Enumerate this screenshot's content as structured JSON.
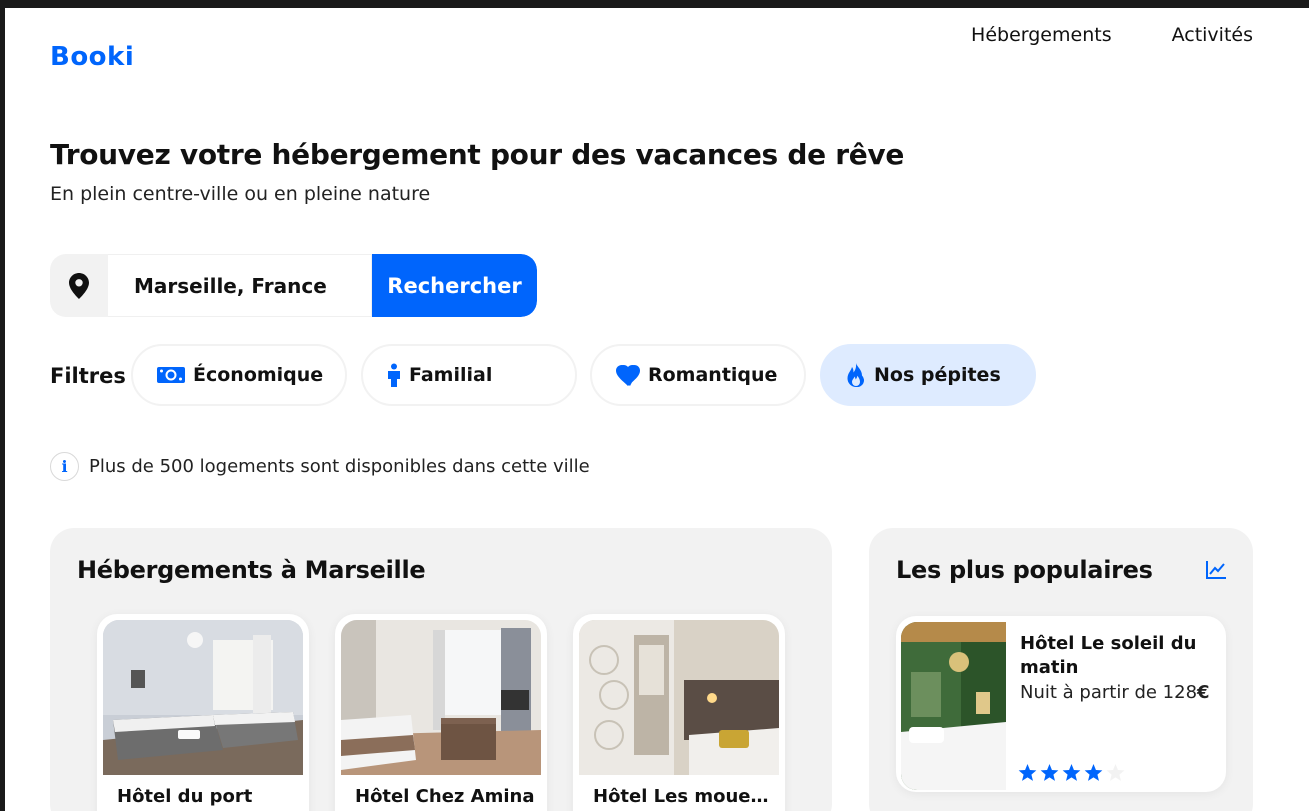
{
  "brand": {
    "logo": "Booki",
    "accent": "#0065fc"
  },
  "nav": {
    "items": [
      "Hébergements",
      "Activités"
    ]
  },
  "hero": {
    "title": "Trouvez votre hébergement pour des vacances de rêve",
    "subtitle": "En plein centre-ville ou en pleine nature"
  },
  "search": {
    "icon": "location-pin-icon",
    "value": "Marseille, France",
    "button_label": "Rechercher"
  },
  "filters": {
    "label": "Filtres",
    "items": [
      {
        "label": "Économique",
        "icon": "money-icon",
        "active": false
      },
      {
        "label": "Familial",
        "icon": "person-icon",
        "active": false
      },
      {
        "label": "Romantique",
        "icon": "heart-icon",
        "active": false
      },
      {
        "label": "Nos pépites",
        "icon": "fire-icon",
        "active": true
      }
    ]
  },
  "info": {
    "text": "Plus de 500 logements sont disponibles dans cette ville"
  },
  "listings": {
    "title": "Hébergements à Marseille",
    "cards": [
      {
        "name": "Hôtel du port"
      },
      {
        "name": "Hôtel Chez Amina"
      },
      {
        "name": "Hôtel Les mouettes"
      }
    ]
  },
  "popular": {
    "title": "Les plus populaires",
    "icon": "trending-chart-icon",
    "cards": [
      {
        "name": "Hôtel Le soleil du matin",
        "price_prefix": "Nuit à partir de 128",
        "currency": "€",
        "rating": 4,
        "rating_max": 5
      }
    ]
  }
}
